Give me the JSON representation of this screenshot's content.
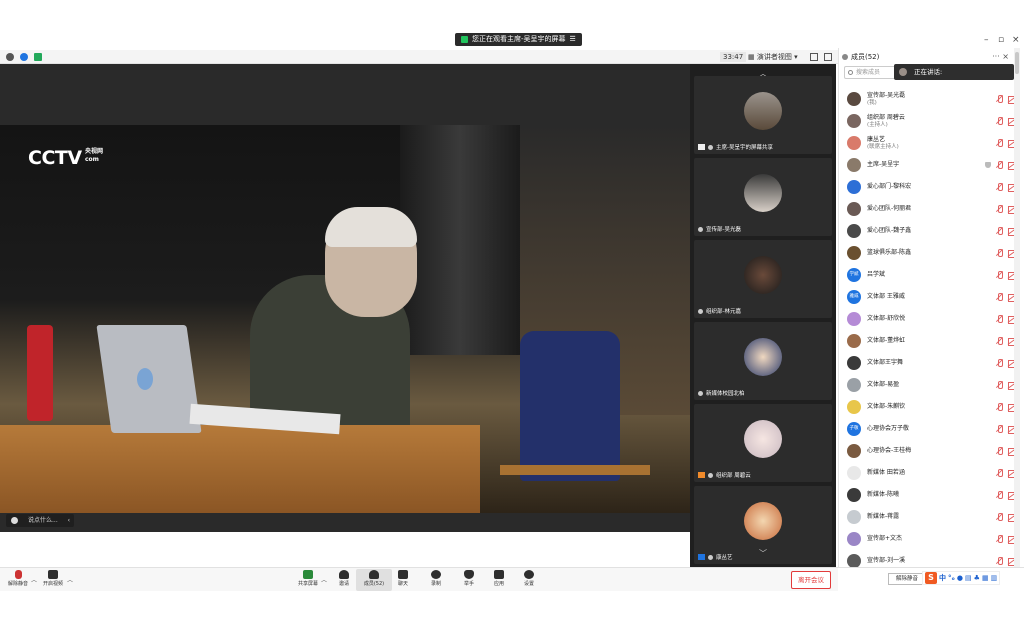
{
  "banner": {
    "text": "您正在观看主席-吴呈宇的屏幕"
  },
  "window": {
    "minimize": "–",
    "restore": "▫",
    "close": "×"
  },
  "meta": {
    "timer": "33:47",
    "view_mode": "演讲者视图"
  },
  "stage": {
    "logo": "CCTV",
    "logo_sub_cn": "央视网",
    "logo_sub_en": "com",
    "chat_placeholder": "说点什么..."
  },
  "thumbnails": [
    {
      "label": "主席-吴呈宇的屏幕共享"
    },
    {
      "label": "宣传部-吴光磊"
    },
    {
      "label": "组织部-林元嘉"
    },
    {
      "label": "新媒体校园北柏"
    },
    {
      "label": "组织部 周碧云"
    },
    {
      "label": "康丛艺"
    }
  ],
  "panel": {
    "title": "成员(52)",
    "search_placeholder": "搜索成员",
    "speaking_label": "正在讲话:",
    "unmute_all": "解除静音"
  },
  "members": [
    {
      "name": "宣传部-吴光磊",
      "sub": "(我)",
      "color": "#5a4a40"
    },
    {
      "name": "组织部 周碧云",
      "sub": "(主持人)",
      "color": "#7a6660"
    },
    {
      "name": "康丛艺",
      "sub": "(联席主持人)",
      "color": "#d97a6a"
    },
    {
      "name": "主席-吴呈宇",
      "sub": "",
      "color": "#8a7a6a"
    },
    {
      "name": "爱心部门-黎科宏",
      "sub": "",
      "color": "#2d6fd6"
    },
    {
      "name": "爱心团队-何丽君",
      "sub": "",
      "color": "#6a5a55"
    },
    {
      "name": "爱心团队-魏子鑫",
      "sub": "",
      "color": "#4a4a4a"
    },
    {
      "name": "篮球俱乐部-陈鑫",
      "sub": "",
      "color": "#6a5030"
    },
    {
      "name": "吕学斌",
      "sub": "",
      "color": "#1f74e0",
      "initials": "学斌"
    },
    {
      "name": "文体部 王雅威",
      "sub": "",
      "color": "#1f74e0",
      "initials": "雅威"
    },
    {
      "name": "文体部-舒欣悦",
      "sub": "",
      "color": "#b58bd6"
    },
    {
      "name": "文体部-董烨虹",
      "sub": "",
      "color": "#9a6b4a"
    },
    {
      "name": "文体部王宇舞",
      "sub": "",
      "color": "#3a3a3a"
    },
    {
      "name": "文体部-易盈",
      "sub": "",
      "color": "#9aa0a6"
    },
    {
      "name": "文体部-朱麒钦",
      "sub": "",
      "color": "#e8c64a"
    },
    {
      "name": "心理协会万子敬",
      "sub": "",
      "color": "#1f74e0",
      "initials": "子敬"
    },
    {
      "name": "心理协会-王桂梅",
      "sub": "",
      "color": "#7a5a40"
    },
    {
      "name": "新媒体 田若涵",
      "sub": "",
      "color": "#e8e8e8"
    },
    {
      "name": "新媒体-陈曦",
      "sub": "",
      "color": "#3a3a3a"
    },
    {
      "name": "新媒体-蒋露",
      "sub": "",
      "color": "#c6cbd0"
    },
    {
      "name": "宣传部+文杰",
      "sub": "",
      "color": "#9a86c6"
    },
    {
      "name": "宣传部-刘一溪",
      "sub": "",
      "color": "#5a5a5a"
    }
  ],
  "toolbar": {
    "unmute": "解除静音",
    "start_video": "开启视频",
    "share": "共享屏幕",
    "invite": "邀请",
    "members": "成员(52)",
    "chat": "聊天",
    "record": "录制",
    "raise_hand": "举手",
    "apps": "应用",
    "settings": "设置",
    "leave": "离开会议"
  },
  "ime": {
    "logo": "S",
    "lang": "中",
    "symbols": "°ₒ"
  },
  "colors": {
    "accent": "#1f74e0",
    "danger": "#e23b3b",
    "muted_icon": "#e06060",
    "dark_bg": "#2a2a2a"
  }
}
